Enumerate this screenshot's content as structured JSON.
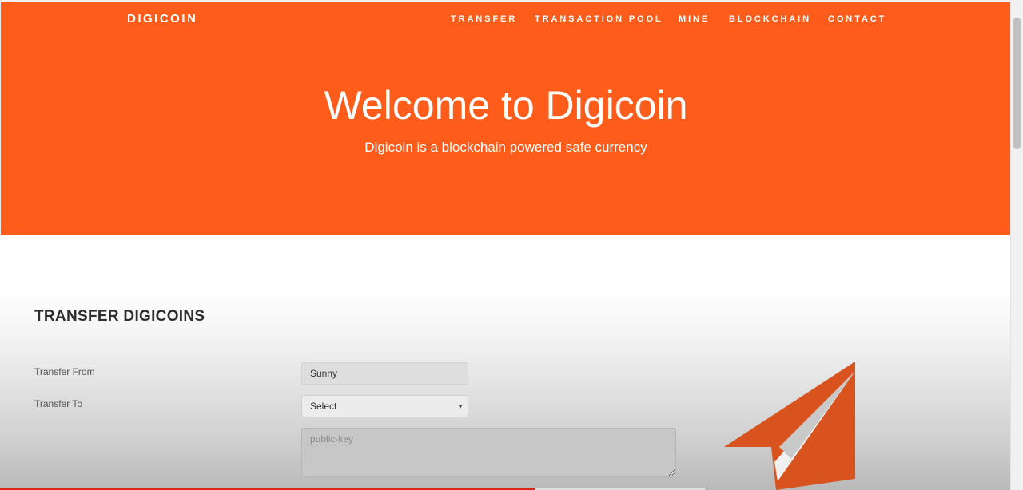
{
  "brand": "DIGICOIN",
  "nav": [
    {
      "label": "TRANSFER"
    },
    {
      "label": "TRANSACTION POOL"
    },
    {
      "label": "MINE"
    },
    {
      "label": "BLOCKCHAIN"
    },
    {
      "label": "CONTACT"
    }
  ],
  "hero": {
    "title": "Welcome to Digicoin",
    "subtitle": "Digicoin is a blockchain powered safe currency"
  },
  "form": {
    "section_title": "TRANSFER DIGICOINS",
    "from_label": "Transfer From",
    "from_value": "Sunny",
    "to_label": "Transfer To",
    "to_selected": "Select",
    "key_placeholder": "public-key"
  },
  "icons": {
    "caret": "▾",
    "illustration": "paper-plane-icon"
  },
  "colors": {
    "accent": "#fe5c1a",
    "plane": "#d9531e"
  }
}
